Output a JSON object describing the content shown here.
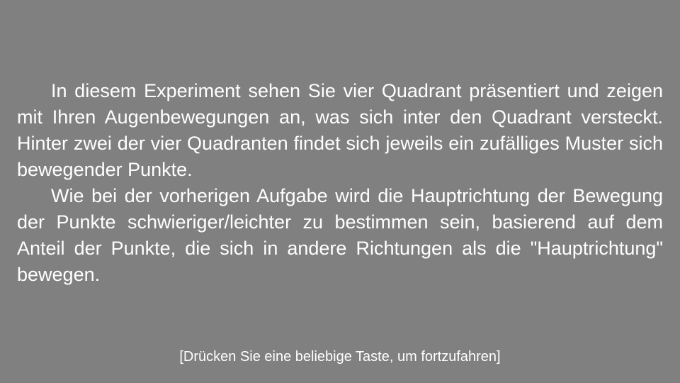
{
  "instructions": {
    "paragraphs": [
      "In diesem Experiment sehen Sie vier Quadrant präsentiert und zeigen mit Ihren Augenbewegungen an, was sich inter den Quadrant versteckt. Hinter zwei der vier Quadranten findet sich jeweils ein zufälliges Muster sich bewegender Punkte.",
      "Wie bei der vorherigen Aufgabe wird die Hauptrichtung der Bewegung der Punkte schwieriger/leichter zu bestimmen sein, basierend auf dem Anteil der Punkte, die sich in andere Richtungen als die \"Hauptrichtung\" bewegen."
    ]
  },
  "prompt": {
    "continue_text": "[Drücken Sie eine beliebige Taste, um fortzufahren]"
  },
  "colors": {
    "background": "#808080",
    "text": "#ffffff"
  }
}
